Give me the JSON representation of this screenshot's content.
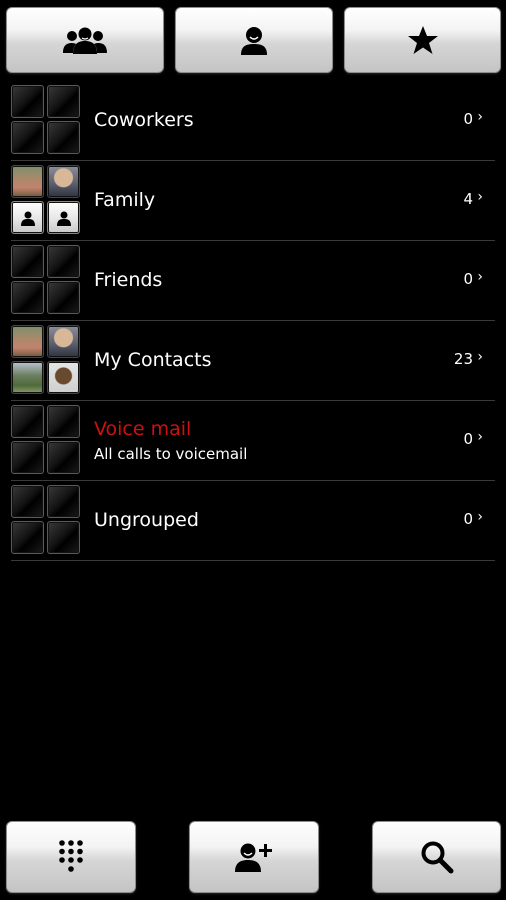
{
  "top_tabs": [
    {
      "icon": "groups-icon"
    },
    {
      "icon": "contact-icon"
    },
    {
      "icon": "star-icon"
    }
  ],
  "groups": [
    {
      "name": "Coworkers",
      "count": "0",
      "thumbnail": "empty",
      "chevron": "›"
    },
    {
      "name": "Family",
      "count": "4",
      "thumbnail": "photos",
      "chevron": "›"
    },
    {
      "name": "Friends",
      "count": "0",
      "thumbnail": "empty",
      "chevron": "›"
    },
    {
      "name": "My Contacts",
      "count": "23",
      "thumbnail": "photos",
      "chevron": "›"
    },
    {
      "name": "Voice mail",
      "subtitle": "All calls to voicemail",
      "count": "0",
      "thumbnail": "empty",
      "name_color": "#cc1111",
      "chevron": "›"
    },
    {
      "name": "Ungrouped",
      "count": "0",
      "thumbnail": "empty",
      "chevron": "›"
    }
  ],
  "bottom_bar": [
    {
      "icon": "dialpad-icon"
    },
    {
      "icon": "add-contact-icon"
    },
    {
      "icon": "search-icon"
    }
  ],
  "colors": {
    "accent_red": "#cc1111",
    "background": "#000000"
  }
}
